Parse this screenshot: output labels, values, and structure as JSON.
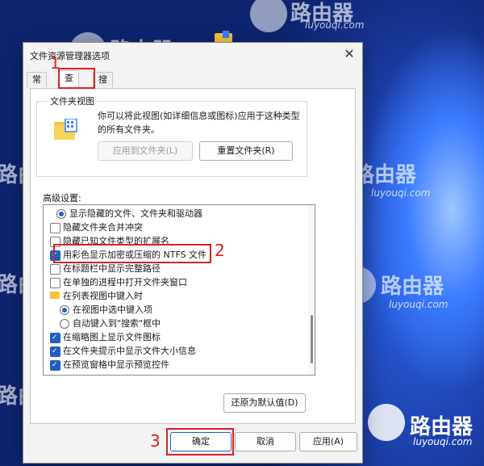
{
  "watermark": {
    "brand": "路由器",
    "url": "luyouqi.com"
  },
  "dialog": {
    "title": "文件资源管理器选项",
    "close_icon": "close-icon",
    "tabs": [
      {
        "label": "常规"
      },
      {
        "label": "查看"
      },
      {
        "label": "搜索"
      }
    ],
    "folder_views": {
      "group_title": "文件夹视图",
      "description": "你可以将此视图(如详细信息或图标)应用于这种类型的所有文件夹。",
      "apply_button": "应用到文件夹(L)",
      "reset_button": "重置文件夹(R)"
    },
    "advanced": {
      "label": "高级设置:",
      "items": [
        {
          "type": "radio",
          "checked": true,
          "label": "显示隐藏的文件、文件夹和驱动器"
        },
        {
          "type": "checkbox",
          "checked": false,
          "label": "隐藏文件夹合并冲突"
        },
        {
          "type": "checkbox",
          "checked": false,
          "label": "隐藏已知文件类型的扩展名"
        },
        {
          "type": "checkbox",
          "checked": true,
          "label": "用彩色显示加密或压缩的 NTFS 文件"
        },
        {
          "type": "checkbox",
          "checked": false,
          "label": "在标题栏中显示完整路径"
        },
        {
          "type": "checkbox",
          "checked": false,
          "label": "在单独的进程中打开文件夹窗口"
        },
        {
          "type": "folder",
          "label": "在列表视图中键入时"
        },
        {
          "type": "radio",
          "checked": true,
          "label": "在视图中选中键入项"
        },
        {
          "type": "radio",
          "checked": false,
          "label": "自动键入到\"搜索\"框中"
        },
        {
          "type": "checkbox",
          "checked": true,
          "label": "在缩略图上显示文件图标"
        },
        {
          "type": "checkbox",
          "checked": true,
          "label": "在文件夹提示中显示文件大小信息"
        },
        {
          "type": "checkbox",
          "checked": true,
          "label": "在预览窗格中显示预览控件"
        }
      ]
    },
    "restore_button": "还原为默认值(D)",
    "ok_button": "确定",
    "cancel_button": "取消",
    "apply_button": "应用(A)"
  },
  "annotations": {
    "step1": "1",
    "step2": "2",
    "step3": "3"
  },
  "colors": {
    "highlight": "#e02020",
    "accent": "#1f5fbf"
  }
}
